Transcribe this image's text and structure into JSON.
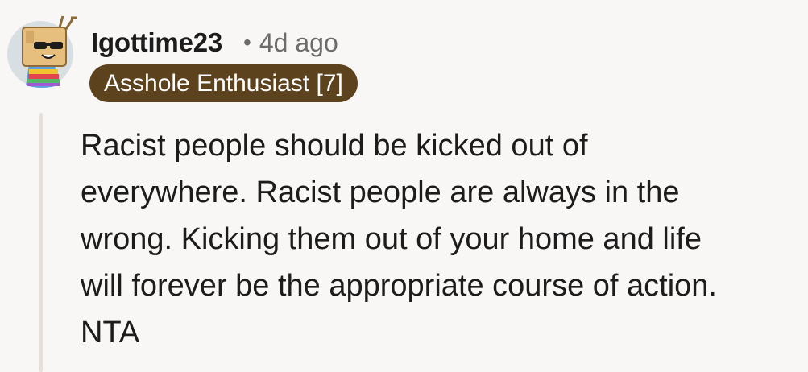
{
  "comment": {
    "author": "Igottime23",
    "separator": "•",
    "timestamp": "4d ago",
    "flair": "Asshole Enthusiast [7]",
    "body_lines": [
      "Racist people should be kicked out of",
      "everywhere. Racist people are always in the",
      "wrong. Kicking them out of your home and life",
      "will forever be the appropriate course of action.",
      "NTA"
    ]
  },
  "avatar": {
    "icon": "robot-sunglasses-avatar-icon"
  },
  "colors": {
    "background": "#f9f7f5",
    "flair_background": "#5c421d",
    "flair_text": "#ffffff",
    "meta_text": "#6b6b6b",
    "thread_line": "#e7e0d8"
  }
}
